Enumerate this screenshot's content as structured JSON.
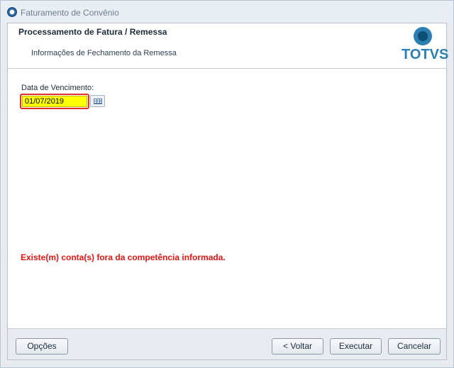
{
  "window": {
    "title": "Faturamento de Convênio"
  },
  "header": {
    "title": "Processamento de Fatura / Remessa",
    "subtitle": "Informações de Fechamento da Remessa",
    "logo_text": "TOTVS"
  },
  "form": {
    "due_date_label": "Data de Vencimento:",
    "due_date_value": "01/07/2019"
  },
  "message": {
    "error": "Existe(m) conta(s) fora da competência informada."
  },
  "footer": {
    "options_label": "Opções",
    "back_label": "< Voltar",
    "execute_label": "Executar",
    "cancel_label": "Cancelar"
  },
  "colors": {
    "error": "#e5130f",
    "field_highlight": "#ffff00",
    "field_border": "#e1322a",
    "brand": "#2a80b0"
  },
  "icons": {
    "app": "app-globe-icon",
    "calendar": "calendar-icon",
    "logo": "totvs-logo-icon"
  }
}
